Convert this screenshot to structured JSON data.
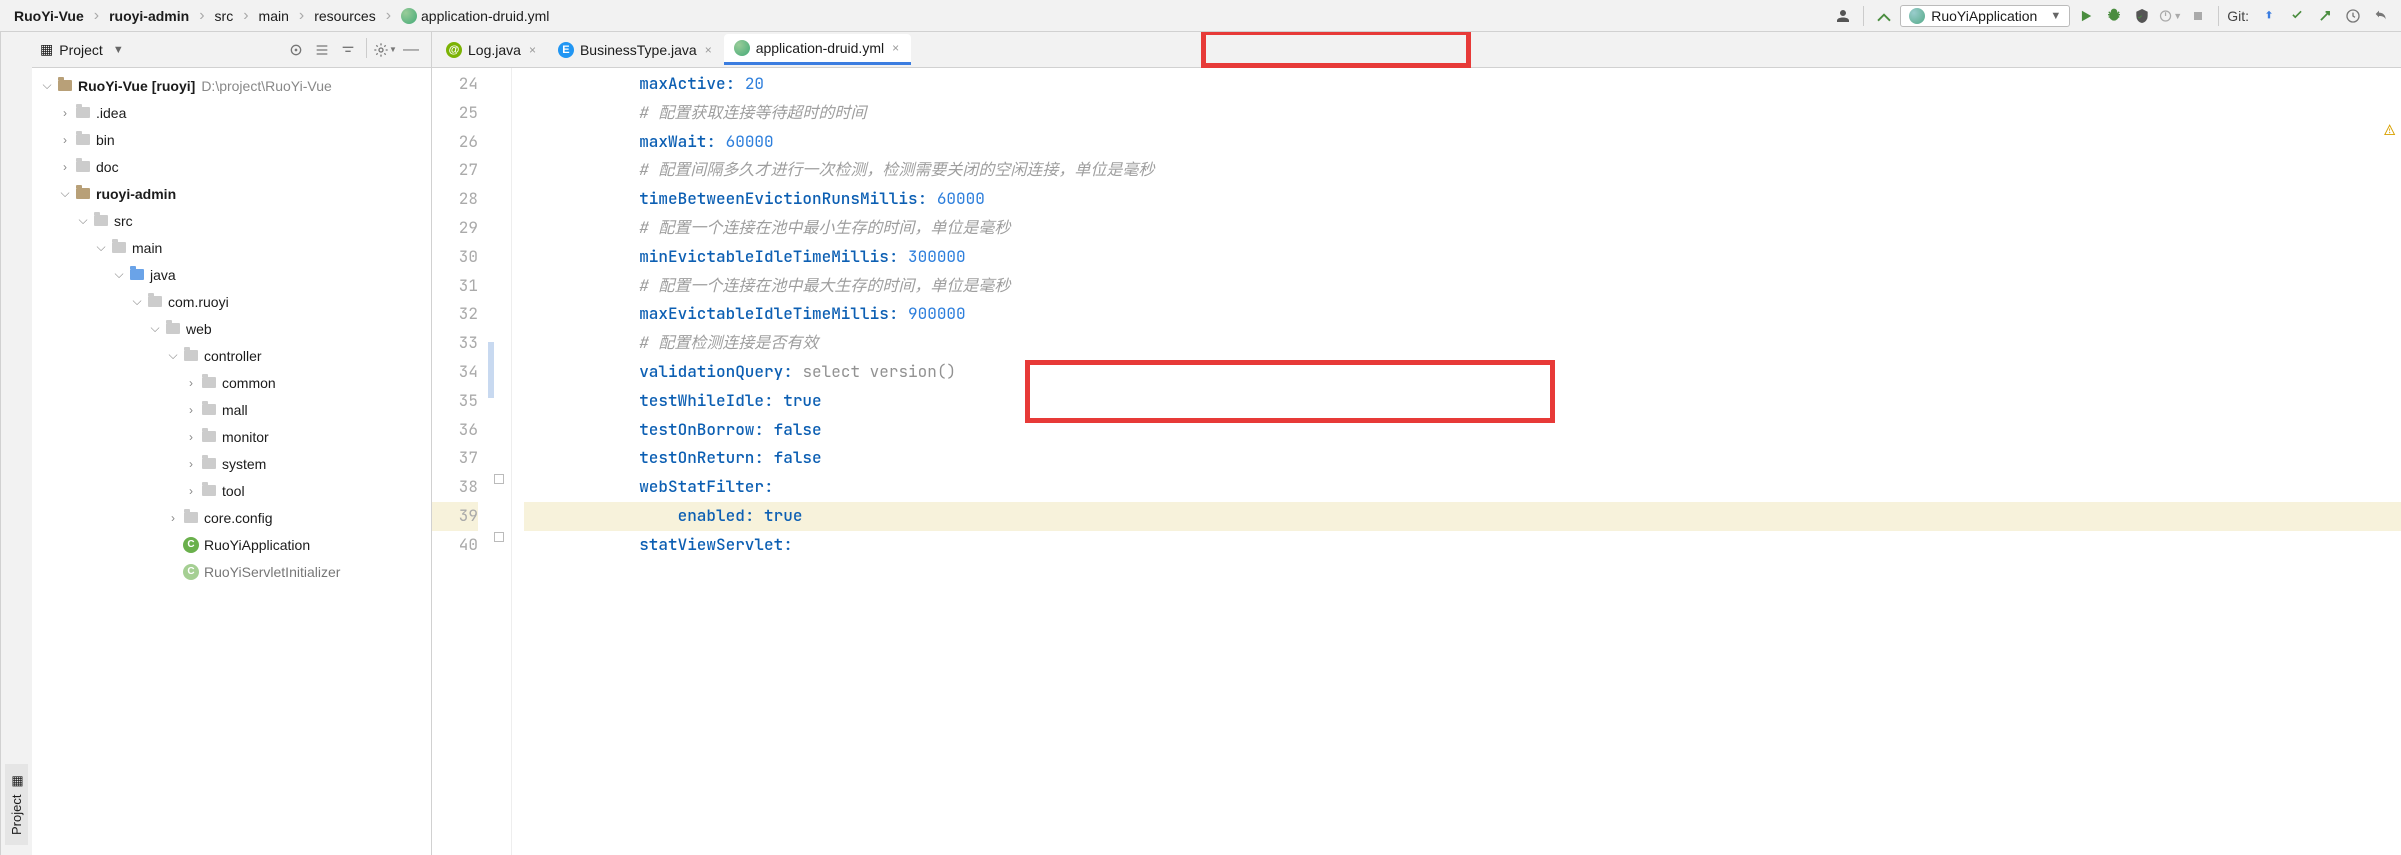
{
  "breadcrumbs": {
    "b0": "RuoYi-Vue",
    "b1": "ruoyi-admin",
    "b2": "src",
    "b3": "main",
    "b4": "resources",
    "b5": "application-druid.yml"
  },
  "run_config": "RuoYiApplication",
  "git_label": "Git:",
  "panel": {
    "title": "Project"
  },
  "sidebar_tab": "Project",
  "tree": {
    "root_name": "RuoYi-Vue",
    "root_ctx": "[ruoyi]",
    "root_path": "D:\\project\\RuoYi-Vue",
    "idea": ".idea",
    "bin": "bin",
    "doc": "doc",
    "admin": "ruoyi-admin",
    "src": "src",
    "main": "main",
    "java": "java",
    "pkg": "com.ruoyi",
    "web": "web",
    "controller": "controller",
    "common": "common",
    "mall": "mall",
    "monitor": "monitor",
    "system": "system",
    "tool": "tool",
    "coreconfig": "core.config",
    "app": "RuoYiApplication",
    "servlet": "RuoYiServletInitializer"
  },
  "tabs": {
    "t0": "Log.java",
    "t1": "BusinessType.java",
    "t2": "application-druid.yml"
  },
  "code": {
    "ln": {
      "l24": "24",
      "l25": "25",
      "l26": "26",
      "l27": "27",
      "l28": "28",
      "l29": "29",
      "l30": "30",
      "l31": "31",
      "l32": "32",
      "l33": "33",
      "l34": "34",
      "l35": "35",
      "l36": "36",
      "l37": "37",
      "l38": "38",
      "l39": "39",
      "l40": "40"
    },
    "l24_key": "maxActive",
    "l24_val": "20",
    "l25_comment": "配置获取连接等待超时的时间",
    "l26_key": "maxWait",
    "l26_val": "60000",
    "l27_comment": "配置间隔多久才进行一次检测，检测需要关闭的空闲连接，单位是毫秒",
    "l28_key": "timeBetweenEvictionRunsMillis",
    "l28_val": "60000",
    "l29_comment": "配置一个连接在池中最小生存的时间，单位是毫秒",
    "l30_key": "minEvictableIdleTimeMillis",
    "l30_val": "300000",
    "l31_comment": "配置一个连接在池中最大生存的时间，单位是毫秒",
    "l32_key": "maxEvictableIdleTimeMillis",
    "l32_val": "900000",
    "l33_comment": "配置检测连接是否有效",
    "l34_key": "validationQuery",
    "l34_val": "select version()",
    "l35_key": "testWhileIdle",
    "l35_val": "true",
    "l36_key": "testOnBorrow",
    "l36_val": "false",
    "l37_key": "testOnReturn",
    "l37_val": "false",
    "l38_key": "webStatFilter",
    "l39_key": "enabled",
    "l39_val": "true",
    "l40_key": "statViewServlet"
  }
}
